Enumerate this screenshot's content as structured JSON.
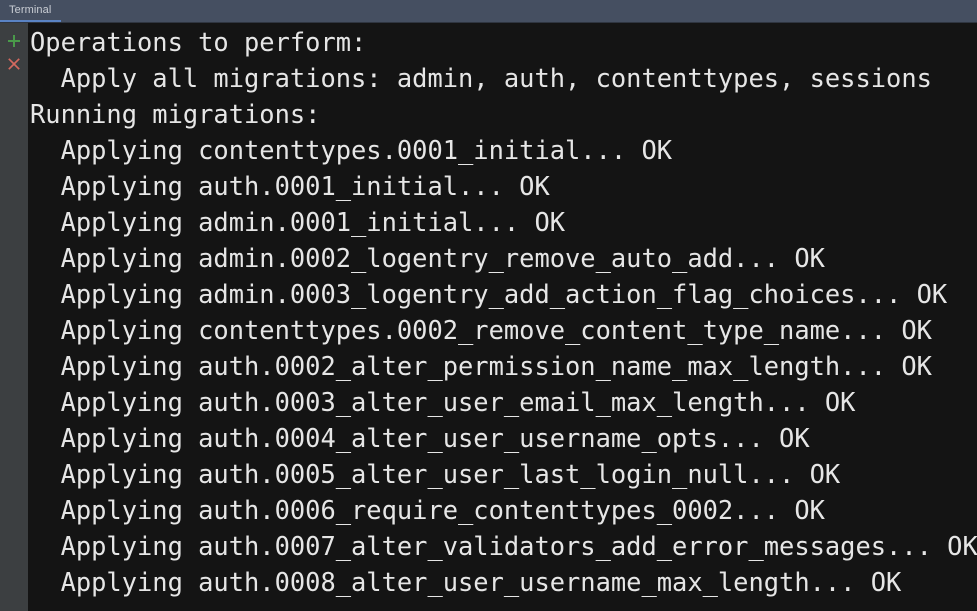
{
  "window": {
    "tab_label": "Terminal"
  },
  "sidebar": {
    "buttons": [
      {
        "name": "new-session-icon",
        "label": "+",
        "color": "#4a9a4a"
      },
      {
        "name": "close-session-icon",
        "label": "×",
        "color": "#d4695f"
      }
    ]
  },
  "terminal": {
    "background_color": "#141414",
    "text_color": "#e6e6e6",
    "lines": [
      "Operations to perform:",
      "  Apply all migrations: admin, auth, contenttypes, sessions",
      "Running migrations:",
      "  Applying contenttypes.0001_initial... OK",
      "  Applying auth.0001_initial... OK",
      "  Applying admin.0001_initial... OK",
      "  Applying admin.0002_logentry_remove_auto_add... OK",
      "  Applying admin.0003_logentry_add_action_flag_choices... OK",
      "  Applying contenttypes.0002_remove_content_type_name... OK",
      "  Applying auth.0002_alter_permission_name_max_length... OK",
      "  Applying auth.0003_alter_user_email_max_length... OK",
      "  Applying auth.0004_alter_user_username_opts... OK",
      "  Applying auth.0005_alter_user_last_login_null... OK",
      "  Applying auth.0006_require_contenttypes_0002... OK",
      "  Applying auth.0007_alter_validators_add_error_messages... OK",
      "  Applying auth.0008_alter_user_username_max_length... OK"
    ]
  }
}
